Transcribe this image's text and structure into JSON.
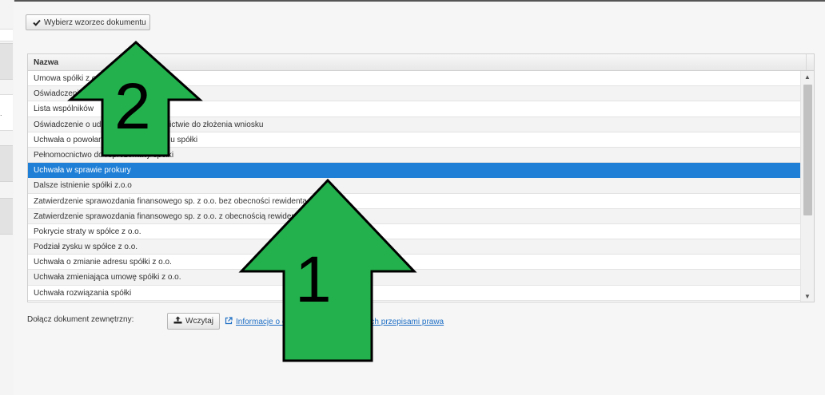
{
  "toolbar": {
    "choose_template_label": "Wybierz wzorzec dokumentu"
  },
  "left_panel": {
    "glyph": "."
  },
  "grid": {
    "column_header": "Nazwa",
    "rows": [
      "Umowa spółki z o.o.",
      "Oświadczenie",
      "Lista wspólników",
      "Oświadczenie o udzieleniu pełnomocnictwie do złożenia wniosku",
      "Uchwała o powołaniu członków zarządu spółki",
      "Pełnomocnictwo do reprezentacji spółki",
      "Uchwała w sprawie prokury",
      "Dalsze istnienie spółki z.o.o",
      "Zatwierdzenie sprawozdania finansowego sp. z o.o. bez obecności rewidenta",
      "Zatwierdzenie sprawozdania finansowego sp. z o.o. z obecnością rewidenta",
      "Pokrycie straty w spółce z o.o.",
      "Podział zysku w spółce z o.o.",
      "Uchwała o zmianie adresu spółki z o.o.",
      "Uchwała zmieniająca umowę spółki z o.o.",
      "Uchwała rozwiązania spółki"
    ],
    "selected_index": 6
  },
  "footer": {
    "attach_label": "Dołącz dokument zewnętrzny:",
    "upload_label": "Wczytaj",
    "info_link": "Informacje o dokumentach wymaganych przepisami prawa"
  },
  "annotations": {
    "arrow_1_label": "1",
    "arrow_2_label": "2",
    "arrow_color": "#22b14c"
  },
  "colors": {
    "selected_row": "#1f7fd6",
    "link": "#1f6fc5"
  },
  "icons": {
    "choose_button": "check-icon",
    "upload_button": "upload-icon",
    "info_link": "external-link-icon",
    "scroll_up": "caret-up-icon",
    "scroll_down": "caret-down-icon"
  }
}
